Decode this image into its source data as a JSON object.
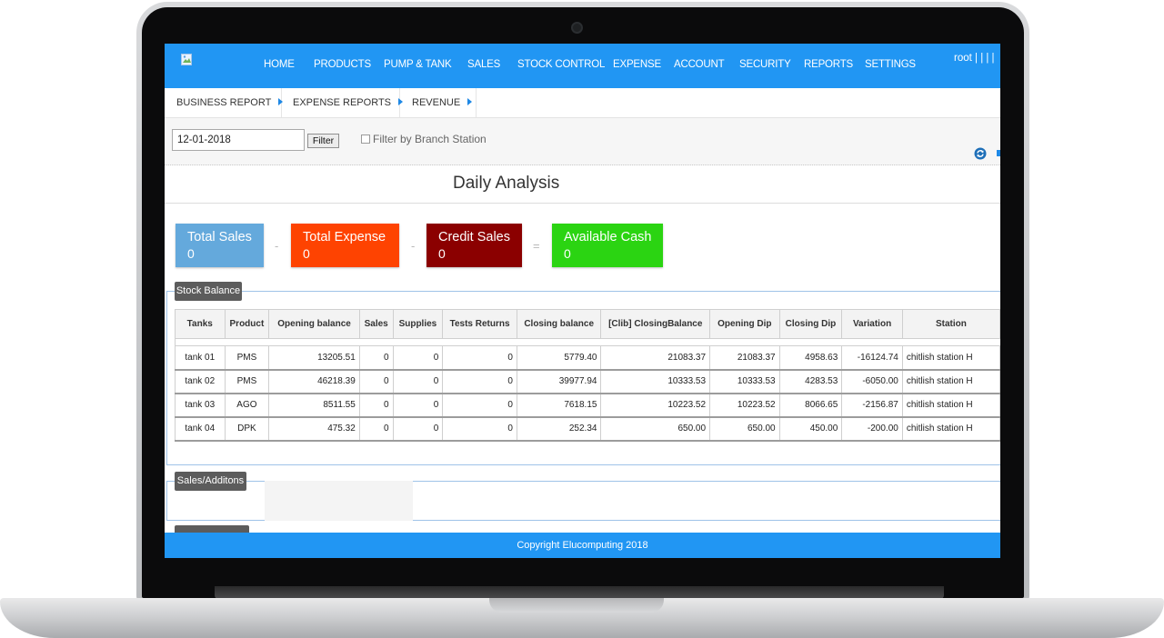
{
  "nav": {
    "items": [
      "HOME",
      "PRODUCTS",
      "PUMP & TANK",
      "SALES",
      "STOCK CONTROL",
      "EXPENSE",
      "ACCOUNT",
      "SECURITY",
      "REPORTS",
      "SETTINGS"
    ],
    "user": "root | | | |"
  },
  "subnav": {
    "tabs": [
      "BUSINESS REPORT",
      "EXPENSE REPORTS",
      "REVENUE"
    ]
  },
  "filter": {
    "date_value": "12-01-2018",
    "button_label": "Filter",
    "branch_label": "Filter by Branch Station",
    "branch_checked": false
  },
  "page_title": "Daily Analysis",
  "summary": {
    "total_sales": {
      "label": "Total Sales",
      "value": "0",
      "color": "#64a9dc"
    },
    "op1": "-",
    "total_expense": {
      "label": "Total Expense",
      "value": "0",
      "color": "#fe4301"
    },
    "op2": "-",
    "credit_sales": {
      "label": "Credit Sales",
      "value": "0",
      "color": "#8b0000"
    },
    "op3": "=",
    "available_cash": {
      "label": "Available Cash",
      "value": "0",
      "color": "#2bd412"
    }
  },
  "stock_balance": {
    "tag": "Stock Balance",
    "columns": [
      "Tanks",
      "Product",
      "Opening balance",
      "Sales",
      "Supplies",
      "Tests Returns",
      "Closing balance",
      "[Clib] ClosingBalance",
      "Opening Dip",
      "Closing Dip",
      "Variation",
      "Station"
    ],
    "rows": [
      [
        "tank 01",
        "PMS",
        "13205.51",
        "0",
        "0",
        "0",
        "5779.40",
        "21083.37",
        "21083.37",
        "4958.63",
        "-16124.74",
        "chitlish station H"
      ],
      [
        "tank 02",
        "PMS",
        "46218.39",
        "0",
        "0",
        "0",
        "39977.94",
        "10333.53",
        "10333.53",
        "4283.53",
        "-6050.00",
        "chitlish station H"
      ],
      [
        "tank 03",
        "AGO",
        "8511.55",
        "0",
        "0",
        "0",
        "7618.15",
        "10223.52",
        "10223.52",
        "8066.65",
        "-2156.87",
        "chitlish station H"
      ],
      [
        "tank 04",
        "DPK",
        "475.32",
        "0",
        "0",
        "0",
        "252.34",
        "650.00",
        "650.00",
        "450.00",
        "-200.00",
        "chitlish station H"
      ]
    ]
  },
  "sales_additions": {
    "tag": "Sales/Additons"
  },
  "footer": "Copyright Elucomputing 2018",
  "colors": {
    "primary": "#2196f3",
    "tag_bg": "#5c5c5c"
  }
}
